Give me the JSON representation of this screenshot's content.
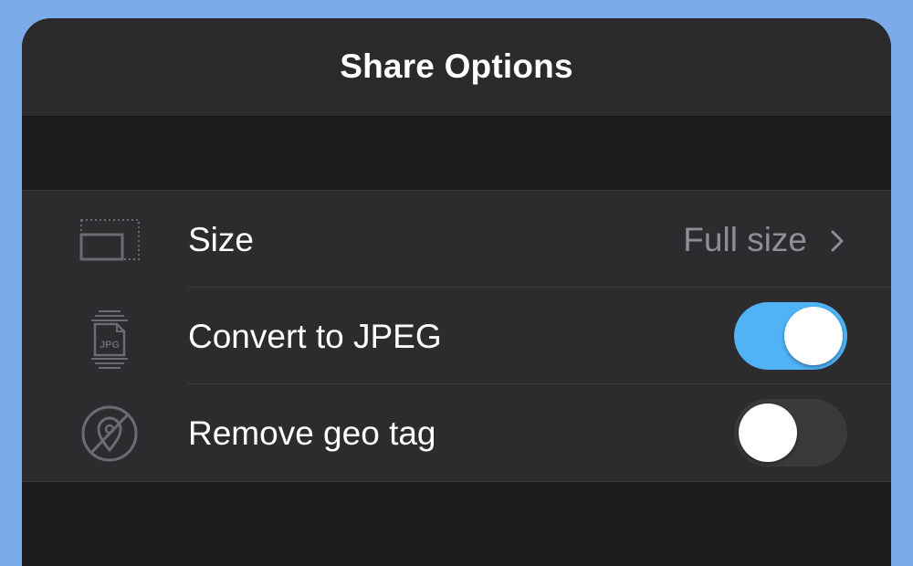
{
  "header": {
    "title": "Share Options"
  },
  "options": {
    "size": {
      "label": "Size",
      "value": "Full size",
      "icon": "image-size-icon"
    },
    "convert_jpeg": {
      "label": "Convert to JPEG",
      "enabled": true,
      "icon": "jpeg-file-icon"
    },
    "remove_geo": {
      "label": "Remove geo tag",
      "enabled": false,
      "icon": "no-location-icon"
    }
  },
  "colors": {
    "background": "#7aaae8",
    "toggle_on": "#4fb3f6",
    "toggle_off": "#3a3a3c"
  }
}
